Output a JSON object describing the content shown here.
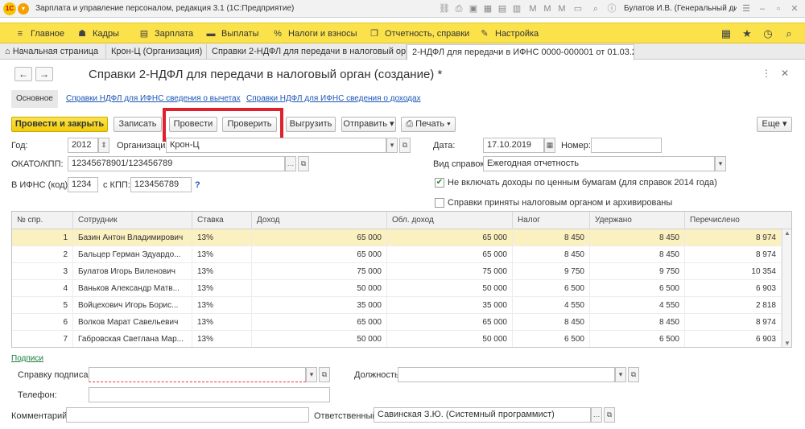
{
  "titlebar": {
    "logo": "1С",
    "title": "Зарплата и управление персоналом, редакция 3.1 (1С:Предприятие)",
    "user": "Булатов И.В. (Генеральный дирек..."
  },
  "sections": [
    {
      "icon": "≡",
      "label": "Главное"
    },
    {
      "icon": "☗",
      "label": "Кадры"
    },
    {
      "icon": "▤",
      "label": "Зарплата"
    },
    {
      "icon": "▬",
      "label": "Выплаты"
    },
    {
      "icon": "%",
      "label": "Налоги и взносы"
    },
    {
      "icon": "❐",
      "label": "Отчетность, справки"
    },
    {
      "icon": "✎",
      "label": "Настройка"
    }
  ],
  "tabs": [
    {
      "label": "Начальная страница",
      "home": true
    },
    {
      "label": "Крон-Ц (Организация)",
      "close": "×"
    },
    {
      "label": "Справки 2-НДФЛ для передачи в налоговый орган",
      "close": "×"
    },
    {
      "label": "2-НДФЛ для передачи в ИФНС 0000-000001 от 01.03.2013",
      "close": "×"
    }
  ],
  "form": {
    "title": "Справки 2-НДФЛ для передачи в налоговый орган (создание) *",
    "subtabs": [
      "Основное",
      "Справки НДФЛ для ИФНС сведения о вычетах",
      "Справки НДФЛ для ИФНС сведения о доходах"
    ],
    "buttons": {
      "post_close": "Провести и закрыть",
      "save": "Записать",
      "post": "Провести",
      "check": "Проверить",
      "export": "Выгрузить",
      "send": "Отправить",
      "print": "Печать",
      "more": "Еще"
    },
    "year_label": "Год:",
    "year_value": "2012",
    "org_label": "Организация:",
    "org_value": "Крон-Ц",
    "date_label": "Дата:",
    "date_value": "17.10.2019",
    "number_label": "Номер:",
    "number_value": "",
    "okato_label": "ОКАТО/КПП:",
    "okato_value": "12345678901/123456789",
    "type_label": "Вид справок:",
    "type_value": "Ежегодная отчетность",
    "ifns_label": "В ИФНС (код):",
    "ifns_value": "1234",
    "kpp_label": "с КПП:",
    "kpp_value": "123456789",
    "help": "?",
    "check1_label": "Не включать доходы по ценным бумагам (для справок 2014 года)",
    "check1_checked": true,
    "check2_label": "Справки приняты налоговым органом и архивированы",
    "check2_checked": false
  },
  "table": {
    "columns": [
      "№ спр.",
      "Сотрудник",
      "Ставка",
      "Доход",
      "Обл. доход",
      "Налог",
      "Удержано",
      "Перечислено"
    ],
    "rows": [
      [
        "1",
        "Базин Антон Владимирович",
        "13%",
        "65 000",
        "65 000",
        "8 450",
        "8 450",
        "8 974"
      ],
      [
        "2",
        "Бальцер Герман Эдуардо...",
        "13%",
        "65 000",
        "65 000",
        "8 450",
        "8 450",
        "8 974"
      ],
      [
        "3",
        "Булатов Игорь Виленович",
        "13%",
        "75 000",
        "75 000",
        "9 750",
        "9 750",
        "10 354"
      ],
      [
        "4",
        "Ваньков Александр Матв...",
        "13%",
        "50 000",
        "50 000",
        "6 500",
        "6 500",
        "6 903"
      ],
      [
        "5",
        "Войцехович Игорь Борис...",
        "13%",
        "35 000",
        "35 000",
        "4 550",
        "4 550",
        "2 818"
      ],
      [
        "6",
        "Волков Марат Савельевич",
        "13%",
        "65 000",
        "65 000",
        "8 450",
        "8 450",
        "8 974"
      ],
      [
        "7",
        "Габровская Светлана Мар...",
        "13%",
        "50 000",
        "50 000",
        "6 500",
        "6 500",
        "6 903"
      ]
    ]
  },
  "bottom": {
    "signatures_link": "Подписи",
    "signed_by_label": "Справку подписал:",
    "signed_by_value": "",
    "position_label": "Должность:",
    "position_value": "",
    "phone_label": "Телефон:",
    "phone_value": "",
    "comment_label": "Комментарий:",
    "comment_value": "",
    "responsible_label": "Ответственный:",
    "responsible_value": "Савинская З.Ю. (Системный программист)"
  }
}
